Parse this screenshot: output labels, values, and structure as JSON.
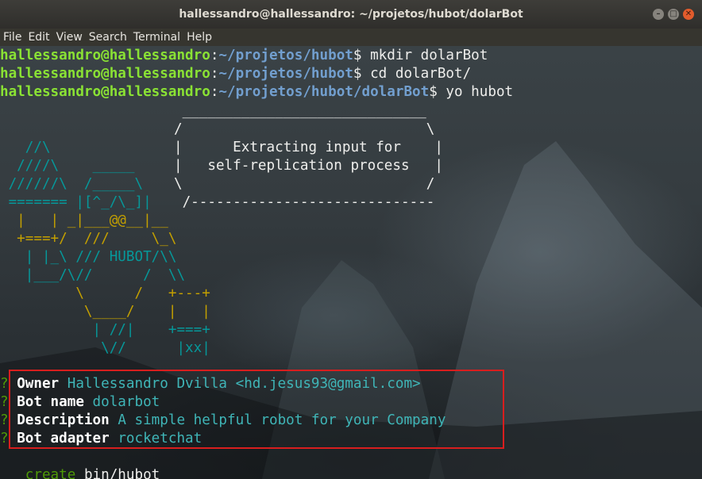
{
  "window": {
    "title": "hallessandro@hallessandro: ~/projetos/hubot/dolarBot",
    "buttons": [
      "–",
      "□",
      "✕"
    ]
  },
  "menu": [
    "File",
    "Edit",
    "View",
    "Search",
    "Terminal",
    "Help"
  ],
  "commands": [
    {
      "user": "hallessandro@hallessandro",
      "sep": ":",
      "path": "~/projetos/hubot",
      "prompt": "$ ",
      "cmd": "mkdir dolarBot"
    },
    {
      "user": "hallessandro@hallessandro",
      "sep": ":",
      "path": "~/projetos/hubot",
      "prompt": "$ ",
      "cmd": "cd dolarBot/"
    },
    {
      "user": "hallessandro@hallessandro",
      "sep": ":",
      "path": "~/projetos/hubot/dolarBot",
      "prompt": "$ ",
      "cmd": "yo hubot"
    }
  ],
  "ascii_art": {
    "robot": [
      "",
      "",
      "   //\\",
      "  ////\\    _____",
      " //////\\  /_____\\",
      " ======= |[^_/\\_]|",
      "  |   | _|___@@__|__",
      "  +===+/  ///     \\_\\",
      "   | |_\\ /// HUBOT/\\\\",
      "   |___/\\//      /  \\\\",
      "         \\      /   +---+",
      "          \\____/    |   |",
      "           | //|    +===+",
      "            \\//      |xx|"
    ],
    "bubble": [
      " _____________________________",
      "/                             \\",
      "|      Extracting input for    |",
      "|   self-replication process   |",
      "\\                             /",
      " /-----------------------------"
    ]
  },
  "answers": [
    {
      "mark": "?",
      "label": "Owner",
      "value": "Hallessandro Dvilla <hd.jesus93@gmail.com>"
    },
    {
      "mark": "?",
      "label": "Bot name",
      "value": "dolarbot"
    },
    {
      "mark": "?",
      "label": "Description",
      "value": "A simple helpful robot for your Company"
    },
    {
      "mark": "?",
      "label": "Bot adapter",
      "value": "rocketchat"
    }
  ],
  "output": [
    {
      "action": "create",
      "file": "bin/hubot"
    }
  ],
  "colors": {
    "user": "#8ae234",
    "path": "#729fcf",
    "art": "#c4a000",
    "art_accent": "#06989a",
    "answer_value": "#3fb5b7",
    "highlight_box": "#d81e1e"
  }
}
